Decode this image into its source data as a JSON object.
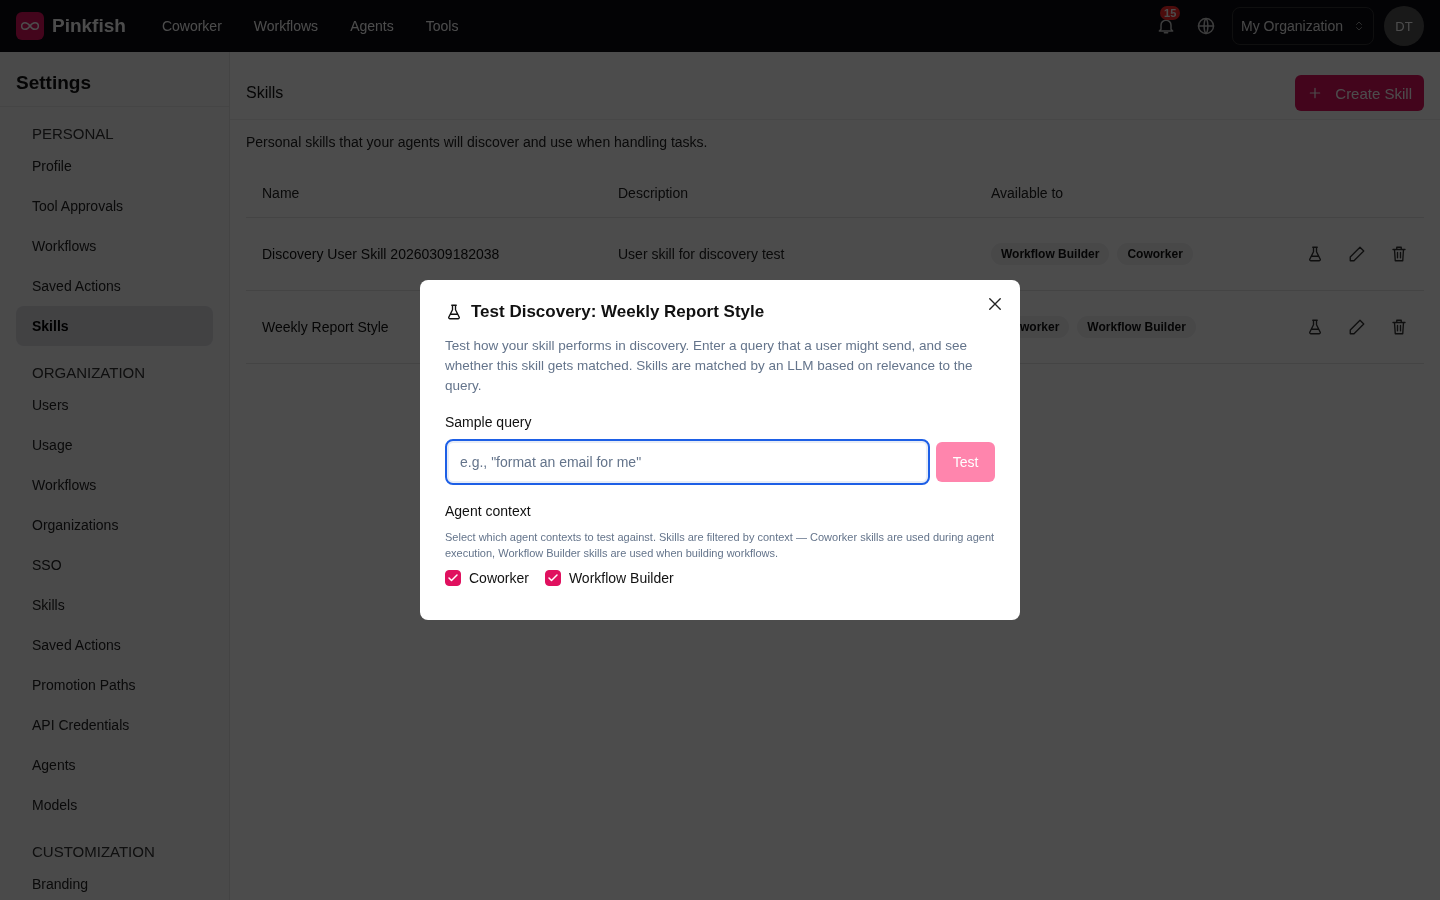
{
  "topbar": {
    "brand": "Pinkfish",
    "nav": [
      "Coworker",
      "Workflows",
      "Agents",
      "Tools"
    ],
    "notifications": "15",
    "organization": "My Organization",
    "avatar": "DT"
  },
  "sidebar": {
    "title": "Settings",
    "sections": [
      {
        "heading": "PERSONAL",
        "items": [
          {
            "label": "Profile",
            "selected": false
          },
          {
            "label": "Tool Approvals",
            "selected": false
          },
          {
            "label": "Workflows",
            "selected": false
          },
          {
            "label": "Saved Actions",
            "selected": false
          },
          {
            "label": "Skills",
            "selected": true
          }
        ]
      },
      {
        "heading": "ORGANIZATION",
        "items": [
          {
            "label": "Users",
            "selected": false
          },
          {
            "label": "Usage",
            "selected": false
          },
          {
            "label": "Workflows",
            "selected": false
          },
          {
            "label": "Organizations",
            "selected": false
          },
          {
            "label": "SSO",
            "selected": false
          },
          {
            "label": "Skills",
            "selected": false
          },
          {
            "label": "Saved Actions",
            "selected": false
          },
          {
            "label": "Promotion Paths",
            "selected": false
          },
          {
            "label": "API Credentials",
            "selected": false
          },
          {
            "label": "Agents",
            "selected": false
          },
          {
            "label": "Models",
            "selected": false
          }
        ]
      },
      {
        "heading": "CUSTOMIZATION",
        "items": [
          {
            "label": "Branding",
            "selected": false
          }
        ]
      }
    ]
  },
  "main": {
    "title": "Skills",
    "create_button": "Create Skill",
    "intro": "Personal skills that your agents will discover and use when handling tasks.",
    "table": {
      "columns": [
        "Name",
        "Description",
        "Available to"
      ],
      "rows": [
        {
          "name": "Discovery User Skill 20260309182038",
          "description": "User skill for discovery test",
          "available_to": [
            {
              "label": "Workflow Builder",
              "cut": false
            },
            {
              "label": "Coworker",
              "cut": false
            }
          ]
        },
        {
          "name": "Weekly Report Style",
          "available_to": [
            {
              "label": "worker",
              "cut": true
            },
            {
              "label": "Workflow Builder",
              "cut": false
            }
          ]
        }
      ]
    }
  },
  "dialog": {
    "title": "Test Discovery: Weekly Report Style",
    "description": "Test how your skill performs in discovery. Enter a query that a user might send, and see whether this skill gets matched. Skills are matched by an LLM based on relevance to the query.",
    "query_label": "Sample query",
    "query_placeholder": "e.g., \"format an email for me\"",
    "test_button": "Test",
    "test_disabled": true,
    "context_label": "Agent context",
    "context_help": "Select which agent contexts to test against. Skills are filtered by context — Coworker skills are used during agent execution, Workflow Builder skills are used when building workflows.",
    "contexts": [
      {
        "label": "Coworker",
        "checked": true
      },
      {
        "label": "Workflow Builder",
        "checked": true
      }
    ]
  }
}
